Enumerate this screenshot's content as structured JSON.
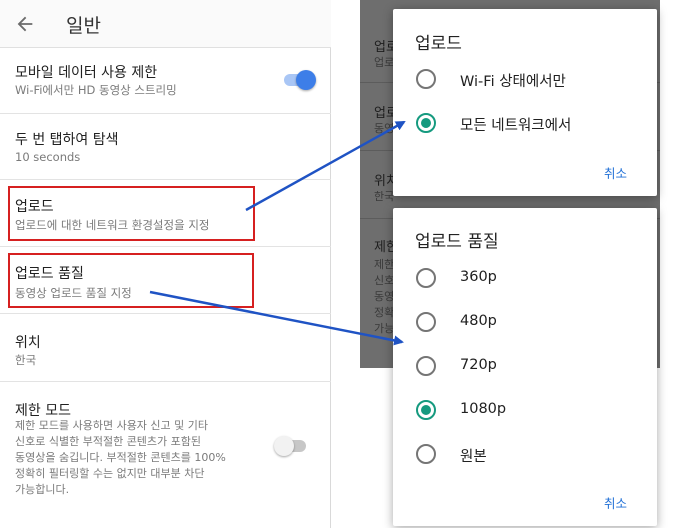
{
  "header": {
    "title": "일반"
  },
  "settings": [
    {
      "title": "모바일 데이터 사용 제한",
      "subtitle": "Wi-Fi에서만 HD 동영상 스트리밍",
      "toggle_on": true
    },
    {
      "title": "두 번 탭하여 탐색",
      "subtitle": "10 seconds"
    },
    {
      "title": "업로드",
      "subtitle": "업로드에 대한 네트워크 환경설정을 지정"
    },
    {
      "title": "업로드 품질",
      "subtitle": "동영상 업로드 품질 지정"
    },
    {
      "title": "위치",
      "subtitle": "한국"
    },
    {
      "title": "제한 모드",
      "subtitle_lines": [
        "제한 모드를 사용하면 사용자 신고 및 기타",
        "신호로 식별한 부적절한 콘텐츠가 포함된",
        "동영상을 숨깁니다. 부적절한 콘텐츠를 100%",
        "정확히 필터링할 수는 없지만 대부분 차단",
        "가능합니다."
      ],
      "toggle_on": false
    }
  ],
  "background_partial": {
    "items": [
      "업로",
      "업로",
      "위치",
      "제한"
    ],
    "subs": [
      "업로",
      "동영",
      "한국",
      "제한",
      "신호",
      "동영",
      "정확",
      "가능"
    ]
  },
  "upload_dialog": {
    "title": "업로드",
    "options": [
      {
        "label": "Wi-Fi 상태에서만",
        "selected": false
      },
      {
        "label": "모든 네트워크에서",
        "selected": true
      }
    ],
    "cancel": "취소"
  },
  "quality_dialog": {
    "title": "업로드 품질",
    "options": [
      {
        "label": "360p",
        "selected": false
      },
      {
        "label": "480p",
        "selected": false
      },
      {
        "label": "720p",
        "selected": false
      },
      {
        "label": "1080p",
        "selected": true
      },
      {
        "label": "원본",
        "selected": false
      }
    ],
    "cancel": "취소"
  },
  "colors": {
    "accent_radio": "#159a7f",
    "toggle_on_thumb": "#3d7ee8",
    "toggle_on_track": "#a9c6f5",
    "highlight_box": "#d62020",
    "arrow": "#1f53c4",
    "cancel_text": "#1f6fd6"
  },
  "icons": {
    "back": "arrow-left-icon"
  }
}
